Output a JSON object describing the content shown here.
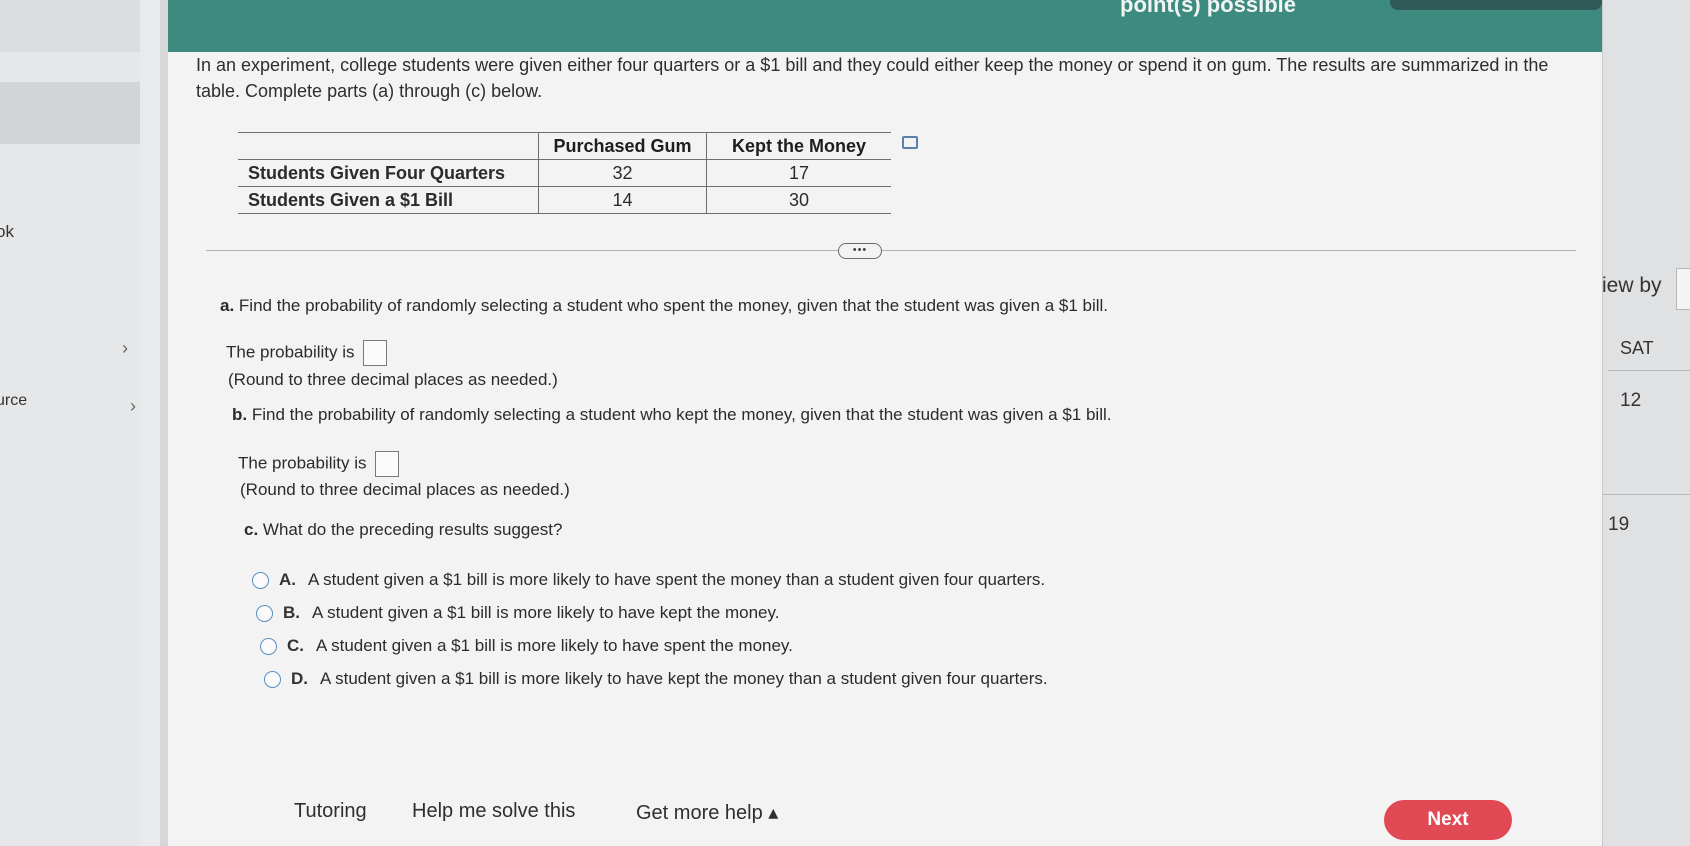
{
  "header": {
    "points_label": "point(s) possible"
  },
  "sidebar": {
    "labels": [
      "ok",
      "urce"
    ]
  },
  "right_panel": {
    "texts": [
      "iew by",
      "SAT",
      "12",
      "19"
    ]
  },
  "intro": "In an experiment, college students were given either four quarters or a $1 bill and they could either keep the money or spend it on gum. The results are summarized in the table. Complete parts (a) through (c) below.",
  "table": {
    "headers": [
      "",
      "Purchased Gum",
      "Kept the Money"
    ],
    "rows": [
      {
        "label": "Students Given Four Quarters",
        "values": [
          "32",
          "17"
        ]
      },
      {
        "label": "Students Given a $1 Bill",
        "values": [
          "14",
          "30"
        ]
      }
    ]
  },
  "more_button": "•••",
  "part_a": {
    "letter": "a.",
    "question": "Find the probability of randomly selecting a student who spent the money, given that the student was given a $1 bill.",
    "prompt": "The probability is",
    "hint": "(Round to three decimal places as needed.)"
  },
  "part_b": {
    "letter": "b.",
    "question": "Find the probability of randomly selecting a student who kept the money, given that the student was given a $1 bill.",
    "prompt": "The probability is",
    "hint": "(Round to three decimal places as needed.)"
  },
  "part_c": {
    "letter": "c.",
    "question": "What do the preceding results suggest?",
    "choices": [
      {
        "letter": "A.",
        "text": "A student given a $1 bill is more likely to have spent the money than a student given four quarters."
      },
      {
        "letter": "B.",
        "text": "A student given a $1 bill is more likely to have kept the money."
      },
      {
        "letter": "C.",
        "text": "A student given a $1 bill is more likely to have spent the money."
      },
      {
        "letter": "D.",
        "text": "A student given a $1 bill is more likely to have kept the money than a student given four quarters."
      }
    ]
  },
  "footer": {
    "tutoring": "Tutoring",
    "help_solve": "Help me solve this",
    "more_help": "Get more help ▴",
    "next": "Next"
  },
  "colors": {
    "header": "#3d8b7f",
    "next_button": "#e14a54",
    "radio": "#5a8fc4"
  }
}
